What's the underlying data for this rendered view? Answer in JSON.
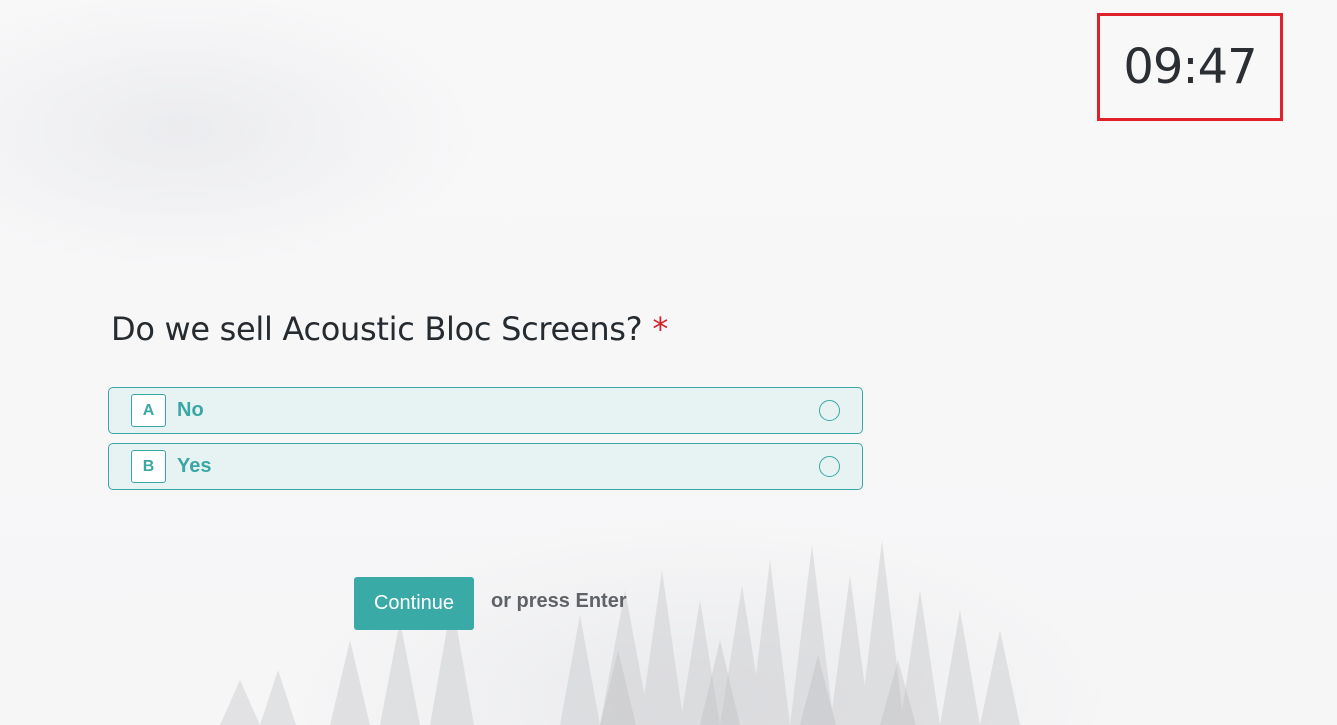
{
  "timer": {
    "value": "09:47",
    "border_color": "#e0202a"
  },
  "question": {
    "text": "Do we sell Acoustic Bloc Screens?",
    "required_mark": "*"
  },
  "options": [
    {
      "key": "A",
      "label": "No"
    },
    {
      "key": "B",
      "label": "Yes"
    }
  ],
  "actions": {
    "continue_label": "Continue",
    "hint": "or press Enter"
  },
  "colors": {
    "accent": "#3aa7a4",
    "required": "#d0262b",
    "text": "#262b30"
  }
}
